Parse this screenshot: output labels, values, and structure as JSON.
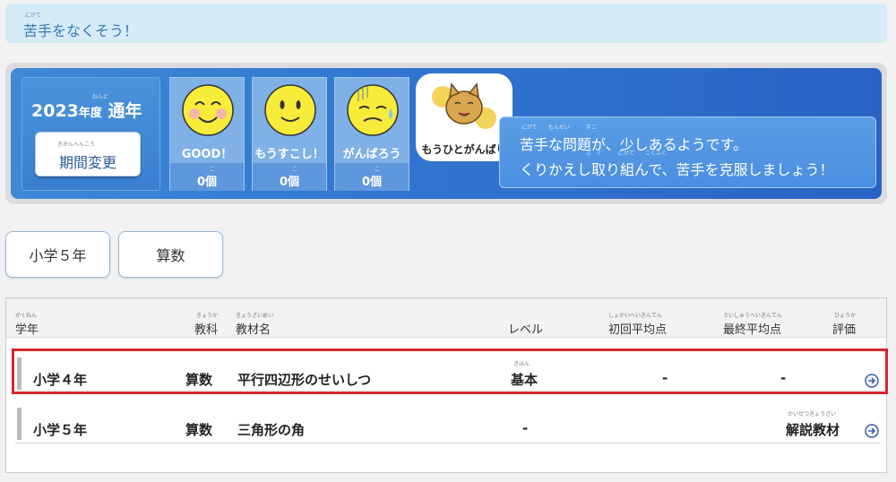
{
  "header": {
    "title": "苦手をなくそう！",
    "title_ruby": "にがて"
  },
  "summary": {
    "year": "2023",
    "year_suffix": "年度",
    "year_ruby": "ねんど",
    "term": "通年",
    "period_button": "期間変更",
    "period_button_ruby": "きかんへんこう",
    "stats": [
      {
        "label": "GOOD！",
        "count": "0",
        "unit": "個",
        "unit_ruby": "こ",
        "face": "happy-face-icon"
      },
      {
        "label": "もうすこし！",
        "count": "0",
        "unit": "個",
        "unit_ruby": "こ",
        "face": "smile-face-icon"
      },
      {
        "label": "がんばろう",
        "count": "0",
        "unit": "個",
        "unit_ruby": "こ",
        "face": "worried-face-icon"
      }
    ],
    "character_label": "もうひとがんばり",
    "message_line1": "苦手な問題が、少しあるようです。",
    "message_line2": "くりかえし取り組んで、苦手を克服しましょう！",
    "message_ruby1": "にがて　　もんだい　　　すこ",
    "message_ruby2": "と　く　　　にがて　　こくふく"
  },
  "filters": {
    "grade": "小学５年",
    "subject": "算数"
  },
  "table": {
    "headers": {
      "grade": "学年",
      "grade_ruby": "がくねん",
      "subject": "教科",
      "subject_ruby": "きょうか",
      "material": "教材名",
      "material_ruby": "きょうざいめい",
      "level": "レベル",
      "first_avg": "初回平均点",
      "first_avg_ruby": "しょかいへいきんてん",
      "final_avg": "最終平均点",
      "final_avg_ruby": "さいしゅうへいきんてん",
      "rating": "評価",
      "rating_ruby": "ひょうか"
    },
    "rows": [
      {
        "grade": "小学４年",
        "subject": "算数",
        "material": "平行四辺形のせいしつ",
        "level": "基本",
        "level_ruby": "きほん",
        "first_avg": "-",
        "final_avg": "-",
        "rating": "",
        "rating_ruby": ""
      },
      {
        "grade": "小学５年",
        "subject": "算数",
        "material": "三角形の角",
        "level": "-",
        "level_ruby": "",
        "first_avg": "",
        "final_avg": "",
        "rating": "解説教材",
        "rating_ruby": "かいせつきょうざい"
      }
    ]
  }
}
